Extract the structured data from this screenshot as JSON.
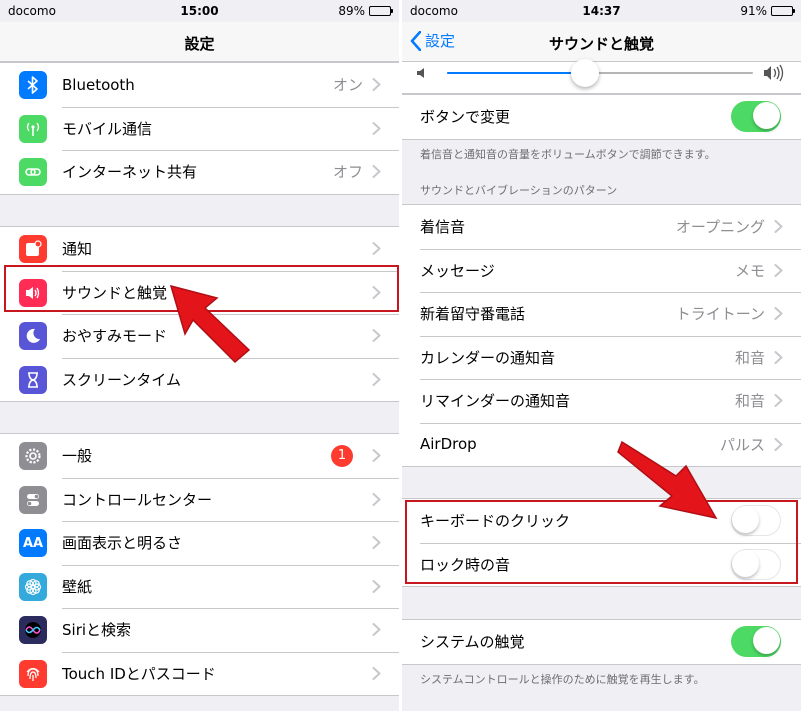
{
  "left": {
    "status": {
      "carrier": "docomo",
      "time": "15:00",
      "battery": "89%",
      "battery_level": 0.89
    },
    "nav_title": "設定",
    "groups": [
      [
        {
          "icon": "bluetooth-icon",
          "color": "#007aff",
          "label": "Bluetooth",
          "value": "オン"
        },
        {
          "icon": "antenna-icon",
          "color": "#4cd964",
          "label": "モバイル通信",
          "value": ""
        },
        {
          "icon": "chain-link-icon",
          "color": "#4cd964",
          "label": "インターネット共有",
          "value": "オフ"
        }
      ],
      [
        {
          "icon": "notification-icon",
          "color": "#ff3b30",
          "label": "通知",
          "value": ""
        },
        {
          "icon": "speaker-icon",
          "color": "#ff2d55",
          "label": "サウンドと触覚",
          "value": ""
        },
        {
          "icon": "moon-icon",
          "color": "#5856d6",
          "label": "おやすみモード",
          "value": ""
        },
        {
          "icon": "hourglass-icon",
          "color": "#5856d6",
          "label": "スクリーンタイム",
          "value": ""
        }
      ],
      [
        {
          "icon": "gear-icon",
          "color": "#8e8e93",
          "label": "一般",
          "value": "",
          "badge": "1"
        },
        {
          "icon": "switches-icon",
          "color": "#8e8e93",
          "label": "コントロールセンター",
          "value": ""
        },
        {
          "icon": "text-size-icon",
          "color": "#007aff",
          "label": "画面表示と明るさ",
          "value": "",
          "glyph": "AA"
        },
        {
          "icon": "flower-icon",
          "color": "#34aadc",
          "label": "壁紙",
          "value": ""
        },
        {
          "icon": "siri-icon",
          "color": "#2b2b5e",
          "label": "Siriと検索",
          "value": ""
        },
        {
          "icon": "fingerprint-icon",
          "color": "#ff3b30",
          "label": "Touch IDとパスコード",
          "value": ""
        }
      ]
    ]
  },
  "right": {
    "status": {
      "carrier": "docomo",
      "time": "14:37",
      "battery": "91%",
      "battery_level": 0.91
    },
    "nav_title": "サウンドと触覚",
    "back_label": "設定",
    "volume_level": 0.45,
    "change_with_buttons": {
      "label": "ボタンで変更",
      "on": true
    },
    "change_note": "着信音と通知音の音量をボリュームボタンで調節できます。",
    "pattern_header": "サウンドとバイブレーションのパターン",
    "patterns": [
      {
        "label": "着信音",
        "value": "オープニング"
      },
      {
        "label": "メッセージ",
        "value": "メモ"
      },
      {
        "label": "新着留守番電話",
        "value": "トライトーン"
      },
      {
        "label": "カレンダーの通知音",
        "value": "和音"
      },
      {
        "label": "リマインダーの通知音",
        "value": "和音"
      },
      {
        "label": "AirDrop",
        "value": "パルス"
      }
    ],
    "keyboard_click": {
      "label": "キーボードのクリック",
      "on": false
    },
    "lock_sound": {
      "label": "ロック時の音",
      "on": false
    },
    "system_haptics": {
      "label": "システムの触覚",
      "on": true
    },
    "system_note": "システムコントロールと操作のために触覚を再生します。"
  },
  "colors": {
    "accent": "#007aff",
    "toggle_on": "#4cd964",
    "highlight": "#c8161e",
    "arrow": "#e4141b"
  }
}
